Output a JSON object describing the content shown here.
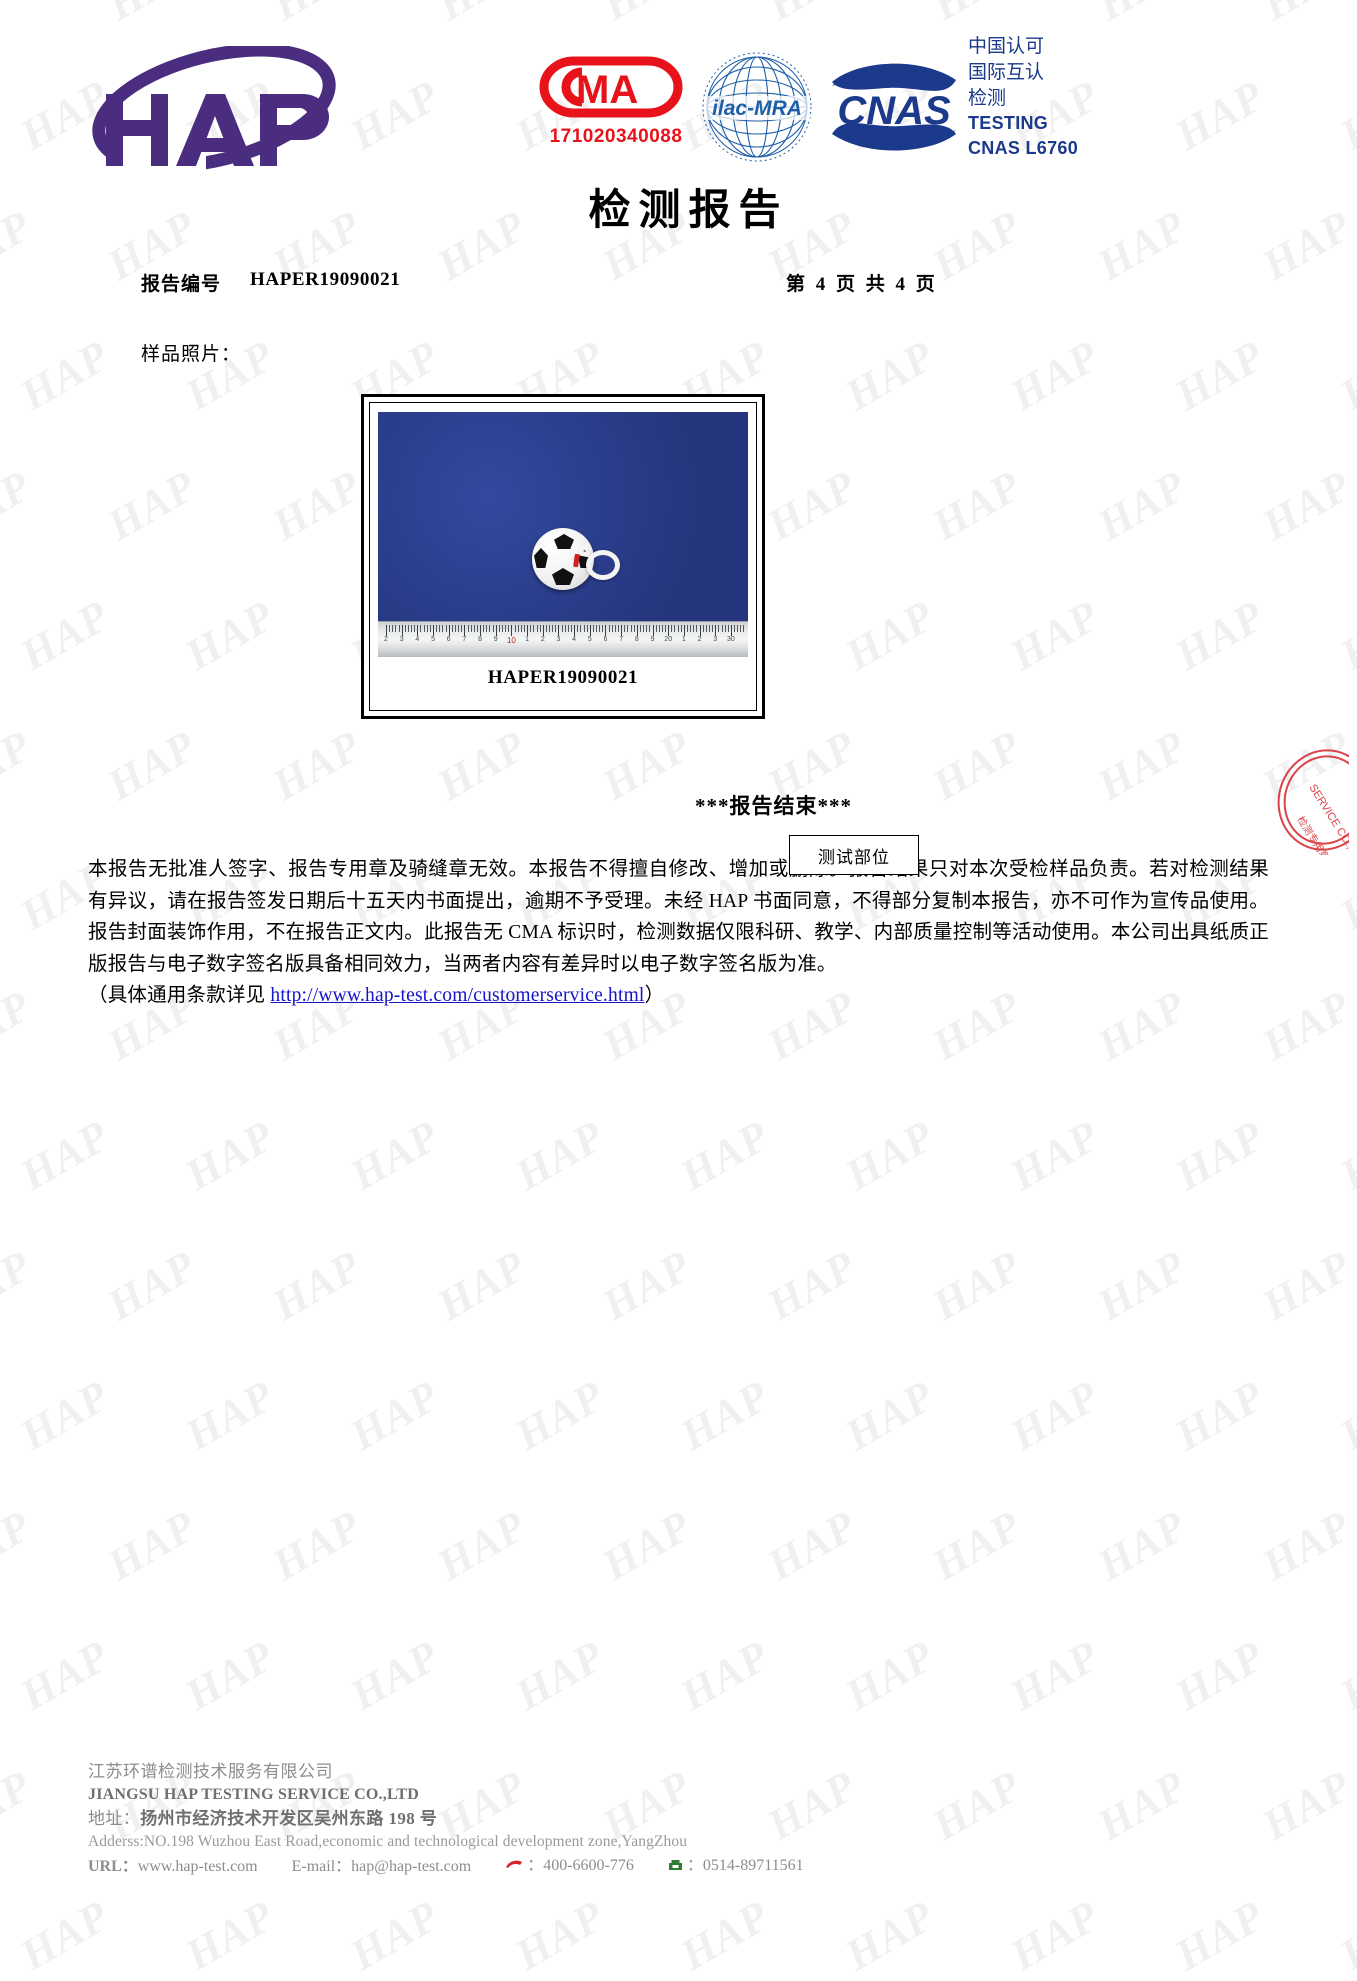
{
  "header": {
    "logo_text": "HAP",
    "cma": {
      "icon": "cma-mark",
      "label": "CMA",
      "number": "171020340088"
    },
    "ilac": {
      "icon": "ilac-mra-mark",
      "label": "ilac-MRA"
    },
    "cnas": {
      "icon": "cnas-mark",
      "label": "CNAS"
    },
    "accreditation": {
      "line1": "中国认可",
      "line2": "国际互认",
      "line3": "检测",
      "line4": "TESTING",
      "line5": "CNAS L6760"
    }
  },
  "title": "检测报告",
  "report": {
    "number_label": "报告编号",
    "number_value": "HAPER19090021",
    "pages": "第 4 页   共 4 页"
  },
  "sample": {
    "section_label": "样品照片：",
    "caption": "HAPER19090021",
    "callout": "测试部位",
    "end_mark": "***报告结束***",
    "ruler_numbers": [
      "2",
      "3",
      "4",
      "5",
      "6",
      "7",
      "8",
      "9",
      "10",
      "1",
      "2",
      "3",
      "4",
      "5",
      "6",
      "7",
      "8",
      "9",
      "20",
      "1",
      "2",
      "3",
      "30"
    ]
  },
  "disclaimer": {
    "body": "本报告无批准人签字、报告专用章及骑缝章无效。本报告不得擅自修改、增加或删除。报告结果只对本次受检样品负责。若对检测结果有异议，请在报告签发日期后十五天内书面提出，逾期不予受理。未经 HAP 书面同意，不得部分复制本报告，亦不可作为宣传品使用。报告封面装饰作用，不在报告正文内。此报告无 CMA 标识时，检测数据仅限科研、教学、内部质量控制等活动使用。本公司出具纸质正版报告与电子数字签名版具备相同效力，当两者内容有差异时以电子数字签名版为准。",
    "terms_prefix": "（具体通用条款详见 ",
    "terms_link": "http://www.hap-test.com/customerservice.html",
    "terms_suffix": "）"
  },
  "footer": {
    "company_cn": "江苏环谱检测技术服务有限公司",
    "company_en": "JIANGSU HAP TESTING SERVICE CO.,LTD",
    "address_cn_label": "地址：",
    "address_cn": "扬州市经济技术开发区吴州东路 198 号",
    "address_en": "Adderss:NO.198 Wuzhou East Road,economic and technological development zone,YangZhou",
    "url_label": "URL：",
    "url_value": "www.hap-test.com",
    "email_label": "E-mail：",
    "email_value": "hap@hap-test.com",
    "phone_value": "400-6600-776",
    "fax_value": "0514-89711561"
  },
  "watermark": {
    "text": "HAP"
  },
  "colors": {
    "logo_purple": "#4b2d7f",
    "cma_red": "#e8131a",
    "cnas_blue": "#1b3a8c",
    "ilac_blue": "#1f5fa8",
    "link_blue": "#1414c8",
    "photo_blue": "#2b3f8f",
    "seal_red": "#d4232a"
  }
}
